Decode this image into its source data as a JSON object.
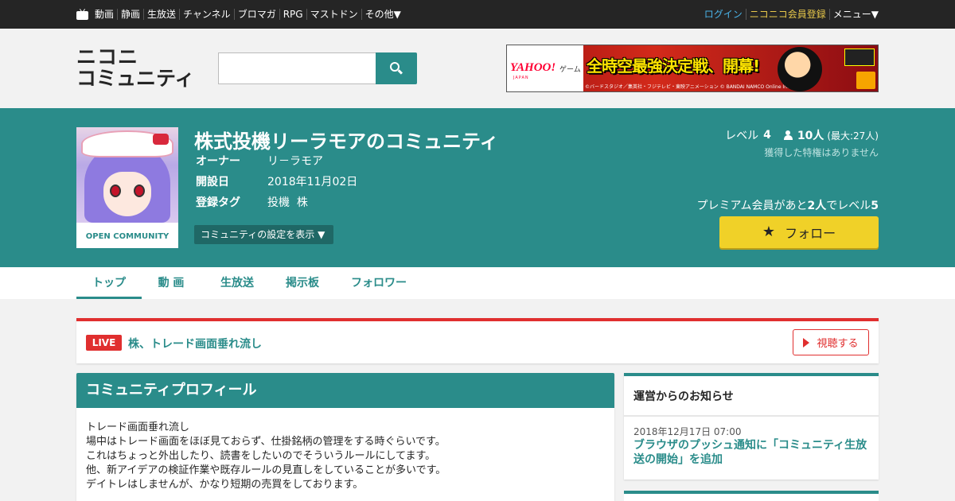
{
  "global_nav": {
    "items": [
      "動画",
      "静画",
      "生放送",
      "チャンネル",
      "ブロマガ",
      "RPG",
      "マストドン",
      "その他▼"
    ],
    "login": "ログイン",
    "register": "ニコニコ会員登録",
    "menu": "メニュー▼"
  },
  "header": {
    "logo_line1": "ニコニ",
    "logo_line2": "コミュニティ",
    "search": {
      "placeholder": "",
      "value": ""
    },
    "ad": {
      "brand": "YAHOO!",
      "brand_sub": "ゲーム",
      "brand_small": "JAPAN",
      "headline": "全時空最強決定戦、開幕!",
      "copyright": "©バードスタジオ／集英社・フジテレビ・東映アニメーション © BANDAI NAMCO Online Inc."
    }
  },
  "community": {
    "thumb_label": "OPEN COMMUNITY",
    "title": "株式投機リーラモアのコミュニティ",
    "fields": [
      {
        "key": "オーナー",
        "value": "リ－ラモア"
      },
      {
        "key": "開設日",
        "value": "2018年11月02日"
      },
      {
        "key": "登録タグ",
        "value": "投機  株"
      }
    ],
    "settings_button": "コミュニティの設定を表示 ▼",
    "level_label": "レベル",
    "level": "4",
    "members": "10人",
    "members_max": "(最大:27人)",
    "privilege_text": "獲得した特権はありません",
    "premium_text_pre": "プレミアム会員があと",
    "premium_count": "2人",
    "premium_text_mid": "でレベル",
    "premium_next_level": "5",
    "follow_button": "フォロー",
    "colors": {
      "accent": "#2a8c8a",
      "follow": "#f0d128",
      "live": "#e02f2f"
    }
  },
  "tabs": [
    {
      "label": "トップ",
      "active": true
    },
    {
      "label": "動 画",
      "active": false
    },
    {
      "label": "生放送",
      "active": false
    },
    {
      "label": "掲示板",
      "active": false
    },
    {
      "label": "フォロワー",
      "active": false
    }
  ],
  "live": {
    "badge": "LIVE",
    "title": "株、トレード画面垂れ流し",
    "watch_button": "視聴する"
  },
  "profile": {
    "heading": "コミュニティプロフィール",
    "lines": [
      "トレード画面垂れ流し",
      "場中はトレード画面をほぼ見ておらず、仕掛銘柄の管理をする時ぐらいです。",
      "これはちょっと外出したり、読書をしたいのでそういうルールにしてます。",
      "他、新アイデアの検証作業や既存ルールの見直しをしていることが多いです。",
      "デイトレはしませんが、かなり短期の売買をしております。"
    ]
  },
  "notice": {
    "heading": "運営からのお知らせ",
    "date": "2018年12月17日 07:00",
    "link": "ブラウザのプッシュ通知に「コミュニティ生放送の開始」を追加"
  }
}
